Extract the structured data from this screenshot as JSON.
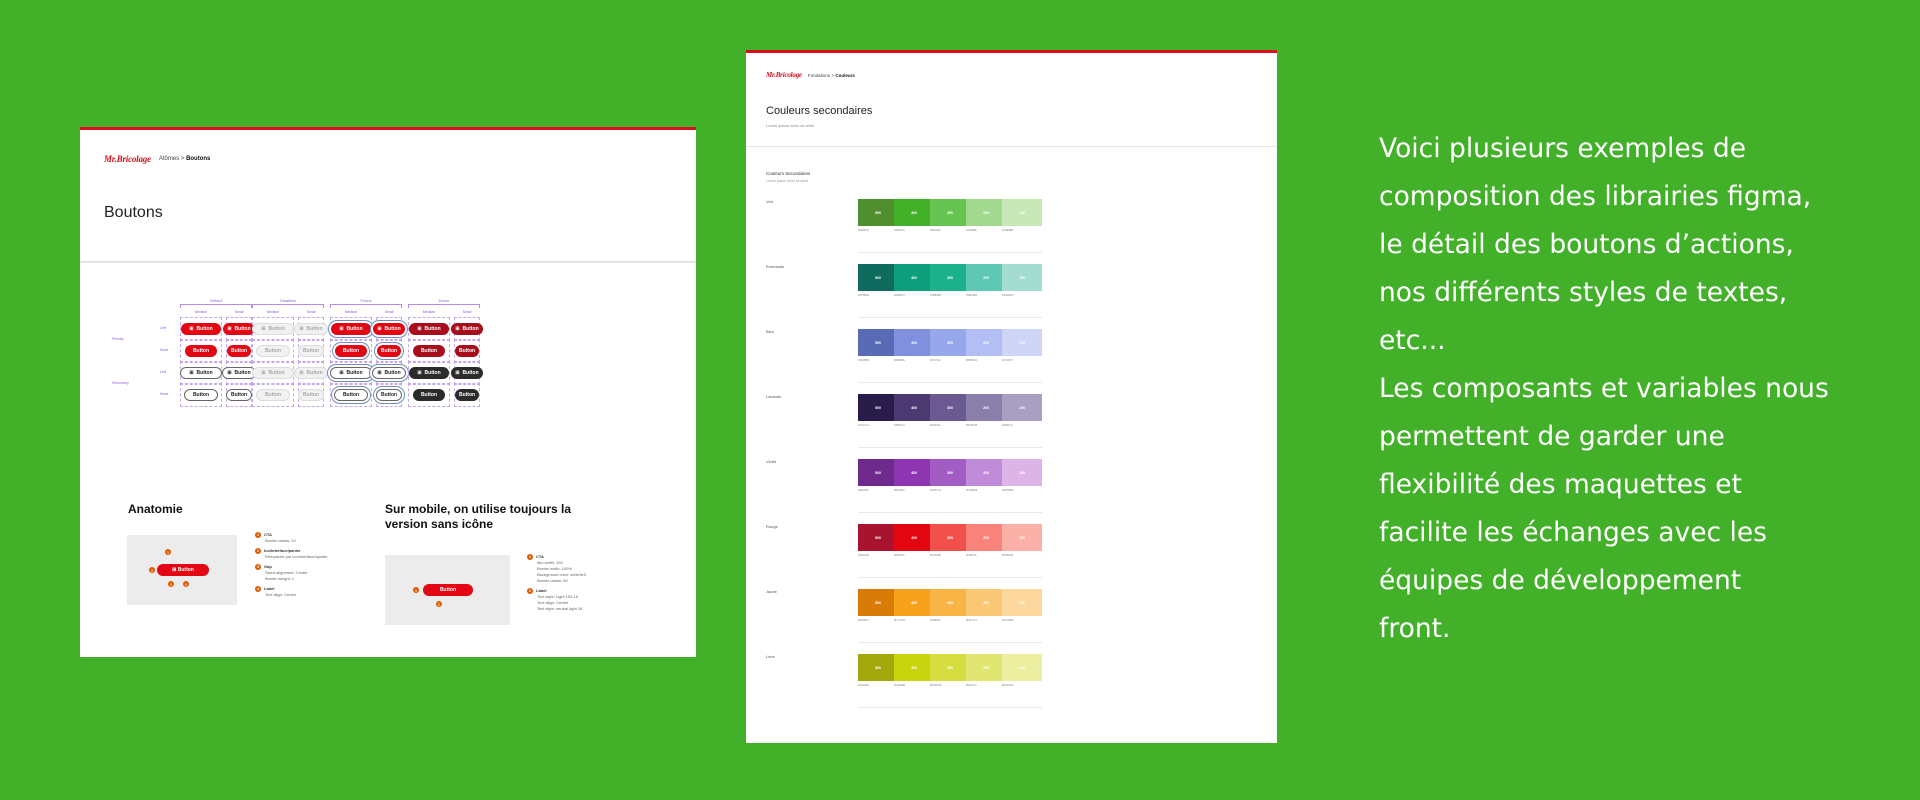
{
  "left": {
    "logo": "Mr.Bricolage",
    "breadcrumb_path": "Atômes",
    "breadcrumb_sep": ">",
    "breadcrumb_current": "Boutons",
    "title": "Boutons",
    "groups": [
      "Défaut",
      "Disabled",
      "Focus",
      "Hover"
    ],
    "columns": [
      "Medium",
      "Small",
      "Medium",
      "Small",
      "Medium",
      "Small",
      "Medium",
      "Small"
    ],
    "row_groups": [
      "Primary",
      "Secondary"
    ],
    "rows": [
      "Left",
      "None",
      "Left",
      "None"
    ],
    "button_label": "Button",
    "anatomy_title": "Anatomie",
    "mobile_title": "Sur mobile, on utilise toujours la version sans icône",
    "anatomy_notes": [
      {
        "n": "1",
        "label": "CTA",
        "sub": [
          "Border radius: 24"
        ]
      },
      {
        "n": "2",
        "label": "Ico/Interface/panier",
        "sub": [
          "Rempacée par Ico/Interface/ajouter"
        ]
      },
      {
        "n": "3",
        "label": "Gap",
        "sub": [
          "Sized alignment: Center",
          "Border weight: 1"
        ]
      },
      {
        "n": "4",
        "label": "Label",
        "sub": [
          "Text align: Center"
        ]
      }
    ],
    "mobile_notes": [
      {
        "n": "1",
        "label": "CTA",
        "sub": [
          "Min width: 160",
          "Border width: 100%",
          "Background color: #e3e3e3",
          "Border radius: 50"
        ]
      },
      {
        "n": "2",
        "label": "Label",
        "sub": [
          "Text style: Light 100-16",
          "Text align: Center",
          "Text style: neutral-light 16"
        ]
      }
    ]
  },
  "middle": {
    "logo": "Mr.Bricolage",
    "breadcrumb_path": "Fondations",
    "breadcrumb_sep": ">",
    "breadcrumb_current": "Couleurs",
    "title": "Couleurs secondaires",
    "subtitle": "Lorem ipsum dolor sit amet",
    "section_title": "Couleurs Secondaires",
    "section_sub": "Lorem ipsum dolor sit amet",
    "palettes": [
      {
        "name": "Vert",
        "shades": [
          "500",
          "400",
          "300",
          "200",
          "100"
        ],
        "colors": [
          "#4f8f2d",
          "#43b02a",
          "#66c550",
          "#a3d88f",
          "#c8e8b8"
        ]
      },
      {
        "name": "Emeraude",
        "shades": [
          "500",
          "400",
          "300",
          "200",
          "100"
        ],
        "colors": [
          "#0f6b5e",
          "#0d9e7c",
          "#1bb28b",
          "#5ec8b4",
          "#a3ddd2"
        ]
      },
      {
        "name": "Bleu",
        "shades": [
          "500",
          "400",
          "300",
          "200",
          "100"
        ],
        "colors": [
          "#5a6bb5",
          "#8090de",
          "#97a7ec",
          "#b3bff4",
          "#cfd5f7"
        ]
      },
      {
        "name": "Lavande",
        "shades": [
          "500",
          "400",
          "300",
          "200",
          "100"
        ],
        "colors": [
          "#2a1c4a",
          "#4b3a72",
          "#6a5a91",
          "#8a7eab",
          "#a89fc2"
        ]
      },
      {
        "name": "Violet",
        "shades": [
          "500",
          "400",
          "300",
          "200",
          "100"
        ],
        "colors": [
          "#6e2a8c",
          "#8e35b1",
          "#a35cc4",
          "#c08bd8",
          "#ddb3e8"
        ]
      },
      {
        "name": "Rouge",
        "shades": [
          "500",
          "400",
          "300",
          "200",
          "100"
        ],
        "colors": [
          "#a8142d",
          "#e30613",
          "#f2504b",
          "#f8837a",
          "#fbb0a8"
        ]
      },
      {
        "name": "Jaune",
        "shades": [
          "500",
          "400",
          "300",
          "200",
          "100"
        ],
        "colors": [
          "#d97b07",
          "#f7a21b",
          "#f8b545",
          "#fac774",
          "#fcd89e"
        ]
      },
      {
        "name": "Lime",
        "shades": [
          "500",
          "400",
          "300",
          "200",
          "100"
        ],
        "colors": [
          "#a3a90d",
          "#c8d50e",
          "#d6dd3e",
          "#e1e672",
          "#ecef9f"
        ]
      }
    ]
  },
  "description": "Voici plusieurs exemples de\ncomposition des librairies figma,\nle détail des boutons d’actions,\nnos différents styles de textes,\netc...\nLes composants et variables nous\npermettent de garder une\nflexibilité des maquettes et\nfacilite les échanges avec les\néquipes de développement\nfront."
}
